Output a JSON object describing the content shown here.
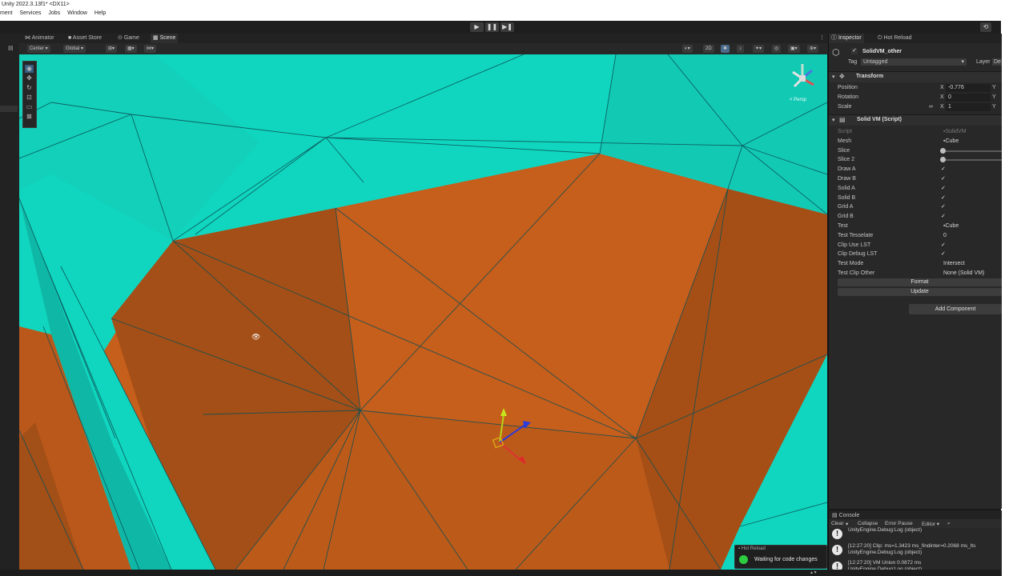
{
  "window": {
    "title": "Unity 2022.3.13f1* <DX11>",
    "menu": [
      "ment",
      "Services",
      "Jobs",
      "Window",
      "Help"
    ]
  },
  "toolbar": {
    "play": "▶",
    "pause": "❚❚",
    "step": "▶❚"
  },
  "tabs": [
    {
      "label": "Animator",
      "icon": "animator-icon"
    },
    {
      "label": "Asset Store",
      "icon": "store-icon"
    },
    {
      "label": "Game",
      "icon": "gamepad-icon"
    },
    {
      "label": "Scene",
      "icon": "scene-grid-icon"
    }
  ],
  "scene_toolbar": {
    "pivot": "Center",
    "space": "Global",
    "mode_2d": "2D"
  },
  "gizmo": {
    "label": "< Persp"
  },
  "inspector": {
    "tabs": {
      "inspector": "Inspector",
      "hot_reload": "Hot Reload"
    },
    "object": {
      "name": "SolidVM_other",
      "tag_label": "Tag",
      "tag": "Untagged",
      "layer_label": "Layer",
      "layer": "De"
    },
    "transform": {
      "title": "Transform",
      "position_label": "Position",
      "rotation_label": "Rotation",
      "scale_label": "Scale",
      "axis_x": "X",
      "axis_y": "Y",
      "position_x": "-0.776",
      "rotation_x": "0",
      "scale_x": "1"
    },
    "component": {
      "title": "Solid VM (Script)",
      "fields": [
        {
          "label": "Script",
          "value": "SolidVM",
          "kind": "object",
          "disabled": true
        },
        {
          "label": "Mesh",
          "value": "Cube",
          "kind": "object"
        },
        {
          "label": "Slice",
          "kind": "slider"
        },
        {
          "label": "Slice 2",
          "kind": "slider"
        },
        {
          "label": "Draw A",
          "kind": "check",
          "value": "✓"
        },
        {
          "label": "Draw B",
          "kind": "check",
          "value": "✓"
        },
        {
          "label": "Solid A",
          "kind": "check",
          "value": "✓"
        },
        {
          "label": "Solid B",
          "kind": "check",
          "value": "✓"
        },
        {
          "label": "Grid A",
          "kind": "check",
          "value": "✓"
        },
        {
          "label": "Grid B",
          "kind": "check",
          "value": "✓"
        },
        {
          "label": "Test",
          "value": "Cube",
          "kind": "object"
        },
        {
          "label": "Test Tesselate",
          "value": "0",
          "kind": "text"
        },
        {
          "label": "Clip Use LST",
          "kind": "check",
          "value": "✓"
        },
        {
          "label": "Clip Debug LST",
          "kind": "check",
          "value": "✓"
        },
        {
          "label": "Test Mode",
          "value": "Intersect",
          "kind": "text"
        },
        {
          "label": "Test Clip Other",
          "value": "None (Solid VM)",
          "kind": "text"
        }
      ],
      "buttons": {
        "format": "Format",
        "update": "Update"
      }
    },
    "add_component": "Add Component"
  },
  "console": {
    "tab": "Console",
    "toolbar": {
      "clear": "Clear",
      "collapse": "Collapse",
      "error_pause": "Error Pause",
      "editor": "Editor"
    },
    "logs": [
      {
        "line1": "UnityEngine.Debug:Log (object)",
        "line2": ""
      },
      {
        "line1": "[12:27:20] Clip: ms=1.3423 ms_findinter=0.2068 ms_lts",
        "line2": "UnityEngine.Debug:Log (object)"
      },
      {
        "line1": "[12:27:20] VM Union 0.0872 ms",
        "line2": "UnityEngine.Debug:Log (object)"
      }
    ]
  },
  "hot_reload_toast": {
    "title": "Hot Reload",
    "status": "Waiting for code changes",
    "status_color": "#2ecc40"
  },
  "colors": {
    "scene_cyan": "#10d6bf",
    "scene_orange": "#c75f1c"
  }
}
